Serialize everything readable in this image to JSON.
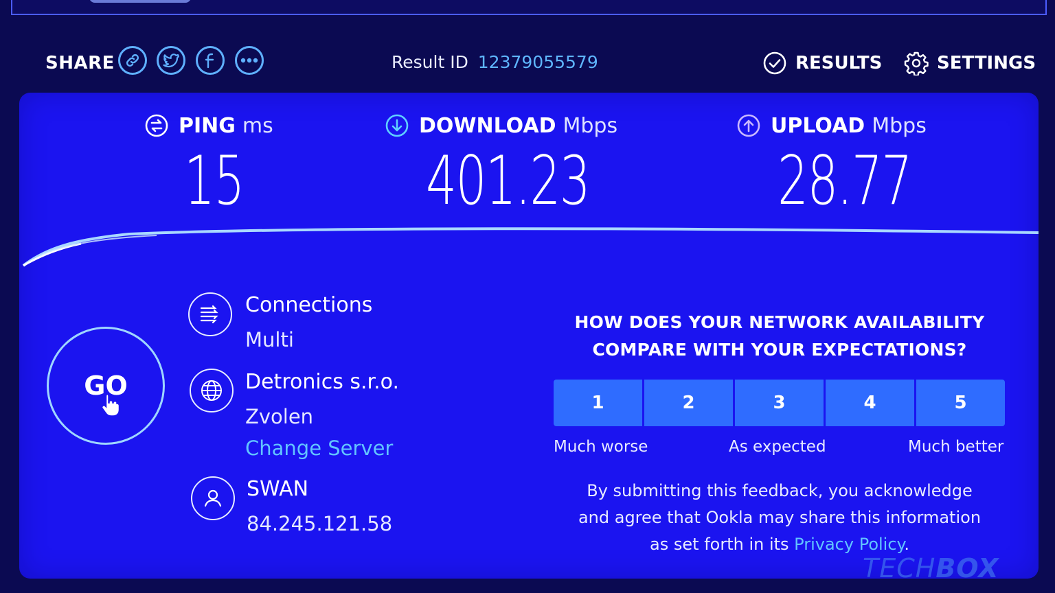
{
  "header": {
    "share_label": "SHARE",
    "share_icons": [
      "link-icon",
      "twitter-icon",
      "facebook-icon",
      "more-icon"
    ],
    "result_id_label": "Result ID",
    "result_id_value": "12379055579",
    "results_label": "RESULTS",
    "settings_label": "SETTINGS"
  },
  "metrics": {
    "ping": {
      "label": "PING",
      "unit": "ms",
      "value": "15"
    },
    "download": {
      "label": "DOWNLOAD",
      "unit": "Mbps",
      "value": "401.23"
    },
    "upload": {
      "label": "UPLOAD",
      "unit": "Mbps",
      "value": "28.77"
    }
  },
  "go_label": "GO",
  "server": {
    "connections_title": "Connections",
    "connections_value": "Multi",
    "provider_name": "Detronics s.r.o.",
    "provider_city": "Zvolen",
    "change_server": "Change Server",
    "isp_name": "SWAN",
    "ip_address": "84.245.121.58"
  },
  "feedback": {
    "question_line1": "HOW DOES YOUR NETWORK AVAILABILITY",
    "question_line2": "COMPARE WITH YOUR EXPECTATIONS?",
    "ratings": [
      "1",
      "2",
      "3",
      "4",
      "5"
    ],
    "scale_low": "Much worse",
    "scale_mid": "As expected",
    "scale_high": "Much better",
    "disclaimer_line1": "By submitting this feedback, you acknowledge",
    "disclaimer_line2": "and agree that Ookla may share this information",
    "disclaimer_line3_prefix": "as set forth in its ",
    "privacy_link": "Privacy Policy",
    "disclaimer_line3_suffix": "."
  },
  "watermark": {
    "part1": "TECH",
    "part2": "BOX"
  },
  "colors": {
    "background": "#0b0a52",
    "panel": "#1b14f0",
    "accent": "#62c4ff",
    "button": "#2f6cff"
  }
}
